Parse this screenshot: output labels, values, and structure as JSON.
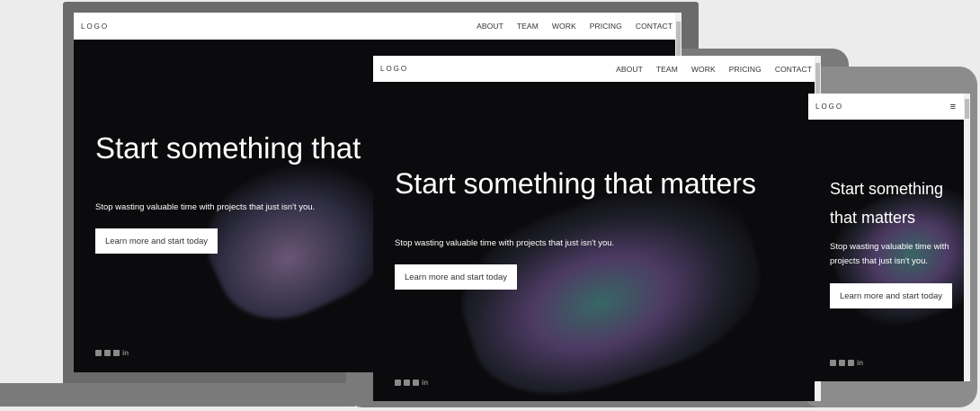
{
  "brand": {
    "logo": "LOGO"
  },
  "nav": {
    "items": [
      "ABOUT",
      "TEAM",
      "WORK",
      "PRICING",
      "CONTACT"
    ]
  },
  "hero": {
    "title": "Start something that matters",
    "title_laptop": "Start something that",
    "title_phone_line1": "Start something",
    "title_phone_line2": "that matters",
    "subtitle": "Stop wasting valuable time with projects that just isn't you.",
    "subtitle_laptop": "Stop wasting valuable time with projects that just isn't you.",
    "subtitle_phone_line1": "Stop wasting valuable time with",
    "subtitle_phone_line2": "projects that just isn't you.",
    "cta": "Learn more and start today"
  },
  "social": {
    "icons": [
      "facebook-icon",
      "flickr-icon",
      "twitter-icon",
      "linkedin-icon"
    ],
    "linkedin_text": "in"
  },
  "menu_icon": "≡",
  "colors": {
    "background": "#ececec",
    "screen": "#0b0b0d",
    "navbar": "#ffffff",
    "device": "#7a7a7a"
  }
}
